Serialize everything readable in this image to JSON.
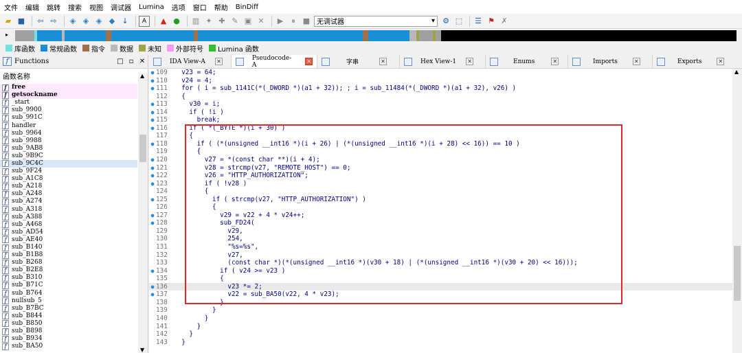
{
  "menu": [
    "文件",
    "编辑",
    "跳转",
    "搜索",
    "视图",
    "调试器",
    "Lumina",
    "选项",
    "窗口",
    "帮助",
    "BinDiff"
  ],
  "toolbar": {
    "debugger_select": "无调试器"
  },
  "legend": [
    {
      "label": "库函数",
      "color": "#6fe3e3"
    },
    {
      "label": "常规函数",
      "color": "#1a8fd8"
    },
    {
      "label": "指令",
      "color": "#a0704a"
    },
    {
      "label": "数据",
      "color": "#b8b8b8"
    },
    {
      "label": "未知",
      "color": "#a2a24a"
    },
    {
      "label": "外部符号",
      "color": "#f79cf2"
    },
    {
      "label": "Lumina 函数",
      "color": "#30c030"
    }
  ],
  "functions_pane": {
    "title": "Functions",
    "column_header": "函数名称",
    "items": [
      {
        "name": "free",
        "kind": "lib"
      },
      {
        "name": "getsockname",
        "kind": "lib"
      },
      {
        "name": "_start",
        "kind": "normal"
      },
      {
        "name": "sub_9900",
        "kind": "normal"
      },
      {
        "name": "sub_991C",
        "kind": "normal"
      },
      {
        "name": "handler",
        "kind": "normal"
      },
      {
        "name": "sub_9964",
        "kind": "normal"
      },
      {
        "name": "sub_9988",
        "kind": "normal"
      },
      {
        "name": "sub_9AB8",
        "kind": "normal"
      },
      {
        "name": "sub_9B9C",
        "kind": "normal"
      },
      {
        "name": "sub_9C4C",
        "kind": "selected"
      },
      {
        "name": "sub_9F24",
        "kind": "normal"
      },
      {
        "name": "sub_A1C8",
        "kind": "normal"
      },
      {
        "name": "sub_A218",
        "kind": "normal"
      },
      {
        "name": "sub_A248",
        "kind": "normal"
      },
      {
        "name": "sub_A274",
        "kind": "normal"
      },
      {
        "name": "sub_A318",
        "kind": "normal"
      },
      {
        "name": "sub_A388",
        "kind": "normal"
      },
      {
        "name": "sub_A468",
        "kind": "normal"
      },
      {
        "name": "sub_AD54",
        "kind": "normal"
      },
      {
        "name": "sub_AE40",
        "kind": "normal"
      },
      {
        "name": "sub_B140",
        "kind": "normal"
      },
      {
        "name": "sub_B1B8",
        "kind": "normal"
      },
      {
        "name": "sub_B268",
        "kind": "normal"
      },
      {
        "name": "sub_B2E8",
        "kind": "normal"
      },
      {
        "name": "sub_B310",
        "kind": "normal"
      },
      {
        "name": "sub_B71C",
        "kind": "normal"
      },
      {
        "name": "sub_B764",
        "kind": "normal"
      },
      {
        "name": "nullsub_5",
        "kind": "normal"
      },
      {
        "name": "sub_B7BC",
        "kind": "normal"
      },
      {
        "name": "sub_B844",
        "kind": "normal"
      },
      {
        "name": "sub_B850",
        "kind": "normal"
      },
      {
        "name": "sub_B898",
        "kind": "normal"
      },
      {
        "name": "sub_B934",
        "kind": "normal"
      },
      {
        "name": "sub_BA50",
        "kind": "normal"
      }
    ]
  },
  "tabs": [
    {
      "label": "IDA View-A",
      "active": false
    },
    {
      "label": "Pseudocode-A",
      "active": true
    },
    {
      "label": "字串",
      "active": false
    },
    {
      "label": "Hex View-1",
      "active": false
    },
    {
      "label": "Enums",
      "active": false
    },
    {
      "label": "Imports",
      "active": false
    },
    {
      "label": "Exports",
      "active": false
    }
  ],
  "code_lines": [
    {
      "n": "109",
      "dot": true,
      "text": "  v23 = 64;"
    },
    {
      "n": "110",
      "dot": true,
      "text": "  v24 = 4;"
    },
    {
      "n": "111",
      "dot": true,
      "text": "  for ( i = sub_1141C(*(_DWORD *)(a1 + 32)); ; i = sub_11484(*(_DWORD *)(a1 + 32), v26) )"
    },
    {
      "n": "112",
      "dot": false,
      "text": "  {"
    },
    {
      "n": "113",
      "dot": true,
      "text": "    v30 = i;"
    },
    {
      "n": "114",
      "dot": true,
      "text": "    if ( !i )"
    },
    {
      "n": "115",
      "dot": true,
      "text": "      break;"
    },
    {
      "n": "116",
      "dot": true,
      "text": "    if ( *(_BYTE *)(i + 30) )"
    },
    {
      "n": "117",
      "dot": false,
      "text": "    {"
    },
    {
      "n": "118",
      "dot": true,
      "text": "      if ( (*(unsigned __int16 *)(i + 26) | (*(unsigned __int16 *)(i + 28) << 16)) == 10 )"
    },
    {
      "n": "119",
      "dot": false,
      "text": "      {"
    },
    {
      "n": "120",
      "dot": true,
      "text": "        v27 = *(const char **)(i + 4);"
    },
    {
      "n": "121",
      "dot": true,
      "text": "        v28 = strcmp(v27, \"REMOTE_HOST\") == 0;"
    },
    {
      "n": "122",
      "dot": true,
      "text": "        v26 = \"HTTP_AUTHORIZATION\";"
    },
    {
      "n": "123",
      "dot": true,
      "text": "        if ( !v28 )"
    },
    {
      "n": "124",
      "dot": false,
      "text": "        {"
    },
    {
      "n": "125",
      "dot": true,
      "text": "          if ( strcmp(v27, \"HTTP_AUTHORIZATION\") )"
    },
    {
      "n": "126",
      "dot": false,
      "text": "          {"
    },
    {
      "n": "127",
      "dot": true,
      "text": "            v29 = v22 + 4 * v24++;"
    },
    {
      "n": "128",
      "dot": true,
      "text": "            sub_FD24("
    },
    {
      "n": "129",
      "dot": false,
      "text": "              v29,"
    },
    {
      "n": "130",
      "dot": false,
      "text": "              254,"
    },
    {
      "n": "131",
      "dot": false,
      "text": "              \"%s=%s\","
    },
    {
      "n": "132",
      "dot": false,
      "text": "              v27,"
    },
    {
      "n": "133",
      "dot": false,
      "text": "              (const char *)(*(unsigned __int16 *)(v30 + 18) | (*(unsigned __int16 *)(v30 + 20) << 16)));"
    },
    {
      "n": "134",
      "dot": true,
      "text": "            if ( v24 >= v23 )"
    },
    {
      "n": "135",
      "dot": false,
      "text": "            {"
    },
    {
      "n": "136",
      "dot": true,
      "text": "              v23 *= 2;",
      "hl": true
    },
    {
      "n": "137",
      "dot": true,
      "text": "              v22 = sub_BA50(v22, 4 * v23);"
    },
    {
      "n": "138",
      "dot": false,
      "text": "            }"
    },
    {
      "n": "139",
      "dot": false,
      "text": "          }"
    },
    {
      "n": "140",
      "dot": false,
      "text": "        }"
    },
    {
      "n": "141",
      "dot": false,
      "text": "      }"
    },
    {
      "n": "142",
      "dot": false,
      "text": "    }"
    },
    {
      "n": "143",
      "dot": false,
      "text": "  }"
    }
  ]
}
